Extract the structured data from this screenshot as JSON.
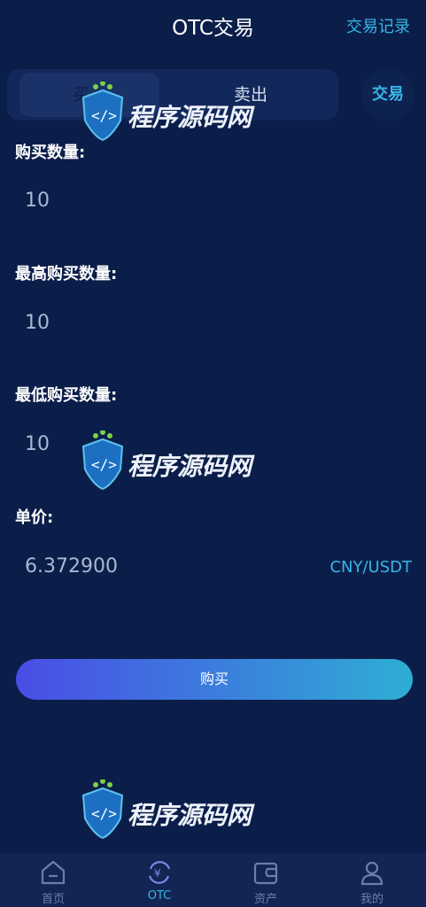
{
  "header": {
    "title": "OTC交易",
    "records_label": "交易记录"
  },
  "segment": {
    "buy_label": "买入",
    "sell_label": "卖出",
    "trade_label": "交易"
  },
  "form": {
    "buy_quantity_label": "购买数量:",
    "buy_quantity_value": "10",
    "max_quantity_label": "最高购买数量:",
    "max_quantity_value": "10",
    "min_quantity_label": "最低购买数量:",
    "min_quantity_value": "10",
    "unit_price_label": "单价:",
    "unit_price_value": "6.372900",
    "unit_price_currency": "CNY/USDT"
  },
  "action": {
    "buy_button_label": "购买"
  },
  "watermark": {
    "text": "程序源码网"
  },
  "tabbar": {
    "items": [
      {
        "label": "首页",
        "icon": "home-icon"
      },
      {
        "label": "OTC",
        "icon": "otc-icon",
        "active": true
      },
      {
        "label": "资产",
        "icon": "wallet-icon"
      },
      {
        "label": "我的",
        "icon": "user-icon"
      }
    ]
  },
  "colors": {
    "background": "#0b1e4a",
    "accent": "#37b6e6",
    "button_start": "#4a4de6",
    "button_end": "#2eaed4"
  }
}
